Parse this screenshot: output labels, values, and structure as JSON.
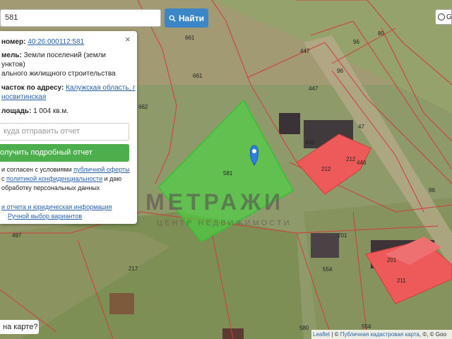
{
  "search": {
    "value": "581",
    "button_label": "Найти"
  },
  "layer_control": {
    "label": "Go"
  },
  "panel": {
    "close_label": "×",
    "cad_number_label": "номер:",
    "cad_number_value": "40:26:000112:581",
    "category_label": "мель:",
    "category_value_1": "Земли поселений (земли",
    "category_value_2": "унктов)",
    "usage_value": "ального жилищного строительства",
    "address_label": "часток по адресу:",
    "address_value_1": "Калужская область, г",
    "address_value_2": "носвитинская",
    "area_label": "лощадь:",
    "area_value": "1 004 кв.м.",
    "email_placeholder": "куда отправить отчет",
    "order_button": "олучить подробный отчет",
    "consent_1": "и согласен с условиями",
    "consent_link_1": "публичной оферты",
    "consent_2": "с",
    "consent_link_2": "политикой конфиденциальности",
    "consent_3": "и даю",
    "consent_4": "обработку персональных данных",
    "link_info": "и отчета и юридическая информация",
    "link_manual": "Ручной выбор вариантов"
  },
  "map": {
    "selected_parcel": "581",
    "parcel_labels": [
      "661",
      "661",
      "662",
      "447",
      "447",
      "96",
      "96",
      "80",
      "47",
      "446",
      "446",
      "212",
      "212",
      "581",
      "497",
      "217",
      "201",
      "201",
      "211",
      "554",
      "554",
      "580",
      "96"
    ],
    "marker_icon": "map-pin-icon",
    "colors": {
      "selected_parcel": "#3de03a",
      "building": "#ee5a5a",
      "boundary": "#d33b3b",
      "marker": "#2f7fe0"
    }
  },
  "watermark": {
    "title": "МЕТРАЖИ",
    "subtitle": "ЦЕНТР НЕДВИЖИМОСТИ"
  },
  "bottom_badge": "на карте?",
  "attribution": {
    "leaflet": "Leaflet",
    "sep": "| ©",
    "provider": "Публичная кадастровая карта",
    "rest": ", ©, © Goo"
  }
}
